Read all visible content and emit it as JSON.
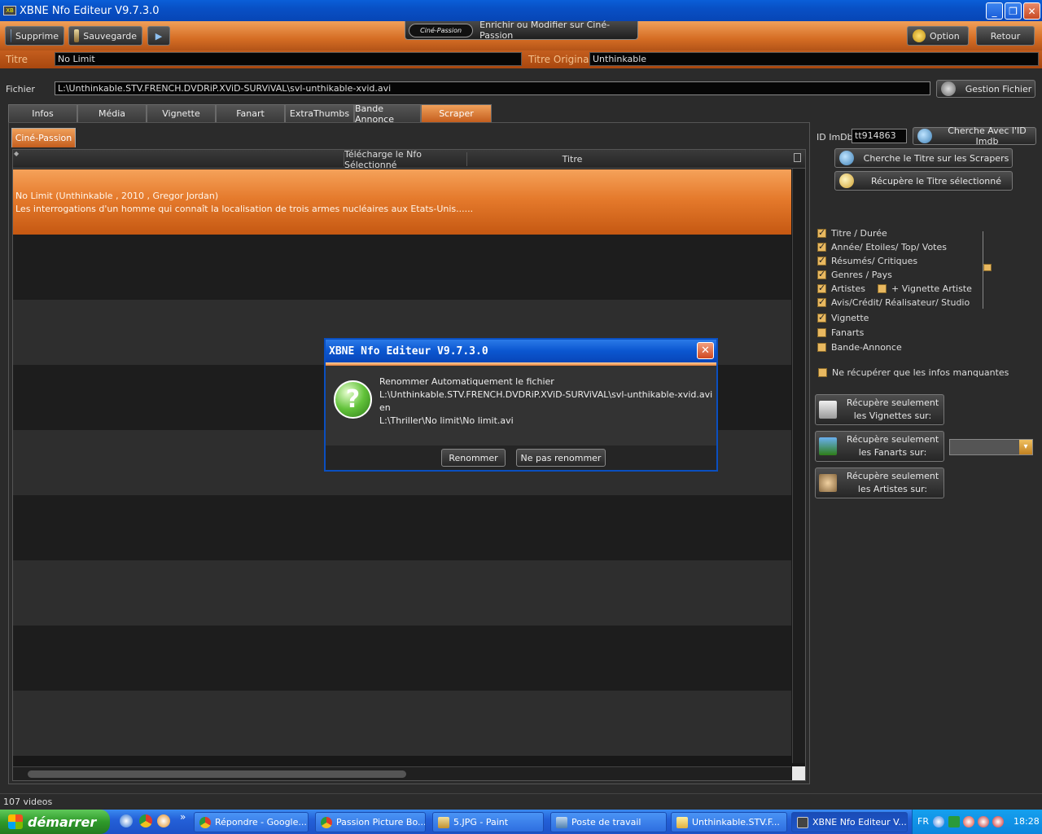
{
  "window": {
    "title": "XBNE Nfo Editeur V9.7.3.0",
    "minimize": "_",
    "maximize": "❐",
    "close": "✕",
    "app_icon": "XB"
  },
  "toolbar": {
    "supprime": "Supprime",
    "sauvegarde": "Sauvegarde",
    "play_icon": "▶",
    "cine_logo": "Ciné-Passion",
    "enrichir": "Enrichir ou Modifier sur Ciné-Passion",
    "option": "Option",
    "retour": "Retour"
  },
  "fields": {
    "titre_label": "Titre",
    "titre_value": "No Limit",
    "titre_original_label": "Titre Original",
    "titre_original_value": "Unthinkable",
    "fichier_label": "Fichier",
    "fichier_value": "L:\\Unthinkable.STV.FRENCH.DVDRiP.XViD-SURViVAL\\svl-unthikable-xvid.avi",
    "gestion_fichier": "Gestion Fichier"
  },
  "tabs": [
    {
      "label": "Infos"
    },
    {
      "label": "Média"
    },
    {
      "label": "Vignette"
    },
    {
      "label": "Fanart"
    },
    {
      "label": "ExtraThumbs"
    },
    {
      "label": "Bande Annonce"
    },
    {
      "label": "Scraper"
    }
  ],
  "subtab": "Ciné-Passion",
  "grid": {
    "col_telecharge": "Télécharge le Nfo Sélectionné",
    "col_titre": "Titre",
    "row1_line1": "No Limit (Unthinkable , 2010 , Gregor Jordan)",
    "row1_line2": "Les interrogations d'un homme qui connaît la localisation de trois armes nucléaires aux Etats-Unis......"
  },
  "right": {
    "idimdb_label": "ID ImDb",
    "idimdb_value": "tt914863",
    "cherche_imdb": "Cherche Avec l'ID Imdb",
    "cherche_titre": "Cherche le Titre sur les Scrapers",
    "recupere_titre": "Récupère le Titre sélectionné",
    "checks": [
      {
        "label": "Titre / Durée",
        "checked": true
      },
      {
        "label": "Année/ Etoiles/ Top/ Votes",
        "checked": true
      },
      {
        "label": "Résumés/ Critiques",
        "checked": true
      },
      {
        "label": "Genres / Pays",
        "checked": true
      },
      {
        "label": "Artistes",
        "checked": true
      },
      {
        "label": "Avis/Crédit/ Réalisateur/ Studio",
        "checked": true
      },
      {
        "label": "Vignette",
        "checked": true
      },
      {
        "label": "Fanarts",
        "checked": false
      },
      {
        "label": "Bande-Annonce",
        "checked": false
      }
    ],
    "vignette_artiste": "+ Vignette Artiste",
    "manquantes": "Ne récupérer que les infos manquantes",
    "vignettes_l1": "Récupère seulement",
    "vignettes_l2": "les Vignettes sur:",
    "fanarts_l1": "Récupère seulement",
    "fanarts_l2": "les Fanarts sur:",
    "artistes_l1": "Récupère seulement",
    "artistes_l2": "les Artistes sur:"
  },
  "dialog": {
    "title": "XBNE Nfo Editeur V9.7.3.0",
    "close": "✕",
    "line1": "Renommer Automatiquement le fichier",
    "line2": "L:\\Unthinkable.STV.FRENCH.DVDRiP.XViD-SURViVAL\\svl-unthikable-xvid.avi",
    "line3": "en",
    "line4": "L:\\Thriller\\No limit\\No limit.avi",
    "question_mark": "?",
    "renommer": "Renommer",
    "ne_pas_renommer": "Ne pas renommer"
  },
  "status": "107 videos",
  "taskbar": {
    "start": "démarrer",
    "more": "»",
    "tasks": [
      "Répondre - Google...",
      "Passion Picture Bo...",
      "5.JPG - Paint",
      "Poste de travail",
      "Unthinkable.STV.F...",
      "XBNE Nfo Editeur V..."
    ],
    "lang": "FR",
    "time": "18:28"
  }
}
